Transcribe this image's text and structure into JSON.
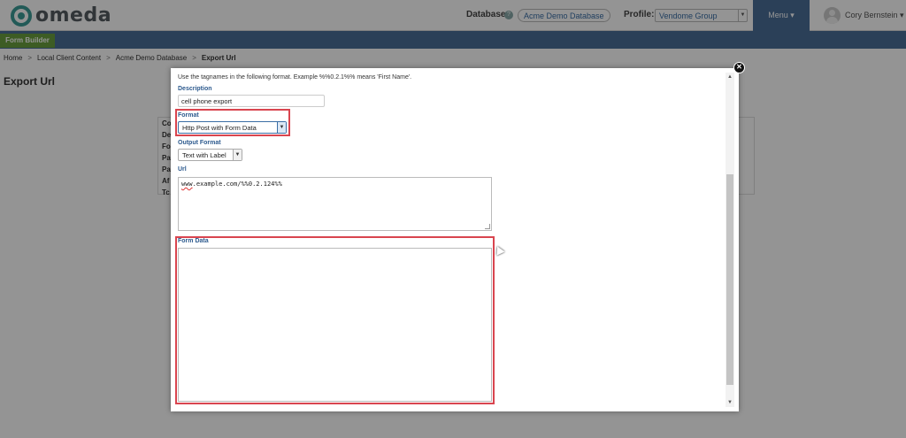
{
  "header": {
    "logo_text": "omeda",
    "database_label": "Database:",
    "database_help": "?",
    "database_value": "Acme Demo Database",
    "profile_label": "Profile:",
    "profile_value": "Vendome Group",
    "menu_label": "Menu ▾",
    "user_name": "Cory Bernstein ▾"
  },
  "nav": {
    "active_tab": "Form Builder"
  },
  "breadcrumb": {
    "items": [
      "Home",
      "Local Client Content",
      "Acme Demo Database"
    ],
    "current": "Export Url",
    "separator": ">"
  },
  "page": {
    "title": "Export Url"
  },
  "background_panel": {
    "labels": [
      "Co",
      "De",
      "Fo",
      "Pa",
      "Pa",
      "Af",
      "Tc"
    ]
  },
  "modal": {
    "help_text": "Use the tagnames in the following format. Example %%0.2.1%% means 'First Name'.",
    "description": {
      "label": "Description",
      "value": "cell phone export"
    },
    "format": {
      "label": "Format",
      "value": "Http Post with Form Data"
    },
    "output_format": {
      "label": "Output Format",
      "value": "Text with Label"
    },
    "url": {
      "label": "Url",
      "value_prefix": "www",
      "value_rest": ".example.com/%%0.2.124%%"
    },
    "form_data": {
      "label": "Form Data",
      "value": ""
    },
    "close_glyph": "✕"
  },
  "colors": {
    "nav_blue": "#4a6f98",
    "tab_green": "#6a9f3e",
    "logo_teal": "#3c9c97",
    "label_blue": "#2d5a8e",
    "highlight_red": "#d9454f"
  }
}
